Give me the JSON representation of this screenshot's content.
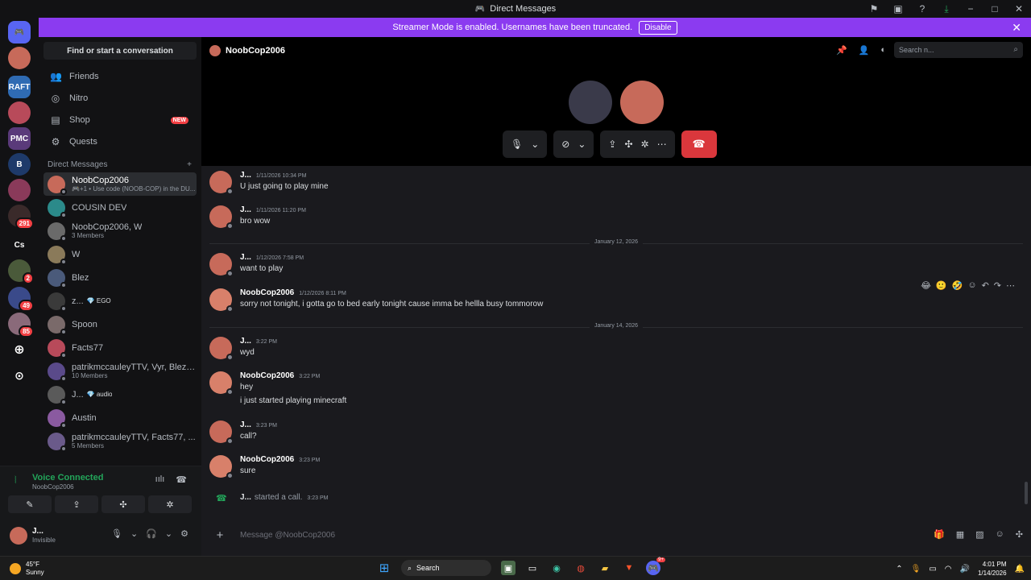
{
  "window": {
    "title": "Direct Messages",
    "controls": [
      "−",
      "□",
      "✕"
    ]
  },
  "streamer": {
    "message": "Streamer Mode is enabled. Usernames have been truncated.",
    "disable_label": "Disable"
  },
  "guilds": [
    {
      "label": "",
      "badge": ""
    },
    {
      "label": "",
      "badge": ""
    },
    {
      "label": "RAFT",
      "badge": ""
    },
    {
      "label": "",
      "badge": ""
    },
    {
      "label": "PMC",
      "badge": ""
    },
    {
      "label": "B",
      "badge": ""
    },
    {
      "label": "",
      "badge": ""
    },
    {
      "label": "",
      "badge": "291"
    },
    {
      "label": "Cs",
      "badge": ""
    },
    {
      "label": "",
      "badge": "2"
    },
    {
      "label": "",
      "badge": "49"
    },
    {
      "label": "",
      "badge": "85"
    }
  ],
  "sidebar": {
    "find_label": "Find or start a conversation",
    "nav": [
      {
        "label": "Friends",
        "icon": "👥"
      },
      {
        "label": "Nitro",
        "icon": "◎"
      },
      {
        "label": "Shop",
        "icon": "🛍",
        "badge": "NEW"
      },
      {
        "label": "Quests",
        "icon": "⚙"
      }
    ],
    "dm_header": "Direct Messages",
    "dm_add": "+",
    "dms": [
      {
        "name": "NoobCop2006",
        "sub": "🎮+1 • Use code (NOOB-COP) in the DU...",
        "tag": "",
        "active": true,
        "color": "#c76a5a"
      },
      {
        "name": "COUSIN DEV",
        "sub": "",
        "tag": "",
        "active": false,
        "color": "#2b8a8a"
      },
      {
        "name": "NoobCop2006, W",
        "sub": "3 Members",
        "tag": "",
        "active": false,
        "color": "#6a6a6a"
      },
      {
        "name": "W",
        "sub": "",
        "tag": "",
        "active": false,
        "color": "#8a7a5a"
      },
      {
        "name": "Blez",
        "sub": "",
        "tag": "",
        "active": false,
        "color": "#4a5a7a"
      },
      {
        "name": "z...",
        "sub": "",
        "tag": "💎 EGO",
        "active": false,
        "color": "#3a3a3a"
      },
      {
        "name": "Spoon",
        "sub": "",
        "tag": "",
        "active": false,
        "color": "#7a6a6a"
      },
      {
        "name": "Facts77",
        "sub": "",
        "tag": "",
        "active": false,
        "color": "#b84a5a"
      },
      {
        "name": "patrikmccauleyTTV, Vyr, Blez, ...",
        "sub": "10 Members",
        "tag": "",
        "active": false,
        "color": "#5a4a8a"
      },
      {
        "name": "J...",
        "sub": "",
        "tag": "💎 audio",
        "active": false,
        "color": "#5a5a5a"
      },
      {
        "name": "Austin",
        "sub": "",
        "tag": "",
        "active": false,
        "color": "#8a5aa0"
      },
      {
        "name": "patrikmccauleyTTV, Facts77, ...",
        "sub": "5 Members",
        "tag": "",
        "active": false,
        "color": "#6a5a8a"
      }
    ]
  },
  "voice": {
    "status": "Voice Connected",
    "channel": "NoobCop2006",
    "buttons": [
      "✎",
      "⇪",
      "✣",
      "✲"
    ]
  },
  "user": {
    "name": "J...",
    "status": "Invisible"
  },
  "call": {
    "title": "NoobCop2006"
  },
  "search": {
    "placeholder": "Search n..."
  },
  "messages": [
    {
      "author": "J...",
      "time": "1/11/2026 10:34 PM",
      "lines": [
        "U just going to play mine"
      ],
      "avatar": "#c76a5a"
    },
    {
      "author": "J...",
      "time": "1/11/2026 11:20 PM",
      "lines": [
        "bro wow"
      ],
      "avatar": "#c76a5a"
    },
    {
      "divider": "January 12, 2026"
    },
    {
      "author": "J...",
      "time": "1/12/2026 7:58 PM",
      "lines": [
        "want to play"
      ],
      "avatar": "#c76a5a"
    },
    {
      "author": "NoobCop2006",
      "time": "1/12/2026 8:11 PM",
      "lines": [
        "sorry not tonight, i gotta go to bed early tonight cause imma be hellla busy tommorow"
      ],
      "avatar": "#d8806a"
    },
    {
      "divider": "January 14, 2026"
    },
    {
      "author": "J...",
      "time": "3:22 PM",
      "lines": [
        "wyd"
      ],
      "avatar": "#c76a5a"
    },
    {
      "author": "NoobCop2006",
      "time": "3:22 PM",
      "lines": [
        "hey",
        "i just started playing minecraft"
      ],
      "avatar": "#d8806a"
    },
    {
      "author": "J...",
      "time": "3:23 PM",
      "lines": [
        "call?"
      ],
      "avatar": "#c76a5a"
    },
    {
      "author": "NoobCop2006",
      "time": "3:23 PM",
      "lines": [
        "sure"
      ],
      "avatar": "#d8806a"
    }
  ],
  "call_event": {
    "author": "J...",
    "text": "started a call.",
    "time": "3:23 PM"
  },
  "composer": {
    "placeholder": "Message @NoobCop2006"
  },
  "taskbar": {
    "temp": "45°F",
    "weather": "Sunny",
    "search": "Search",
    "time": "4:01 PM",
    "date": "1/14/2026",
    "discord_badge": "9+"
  }
}
